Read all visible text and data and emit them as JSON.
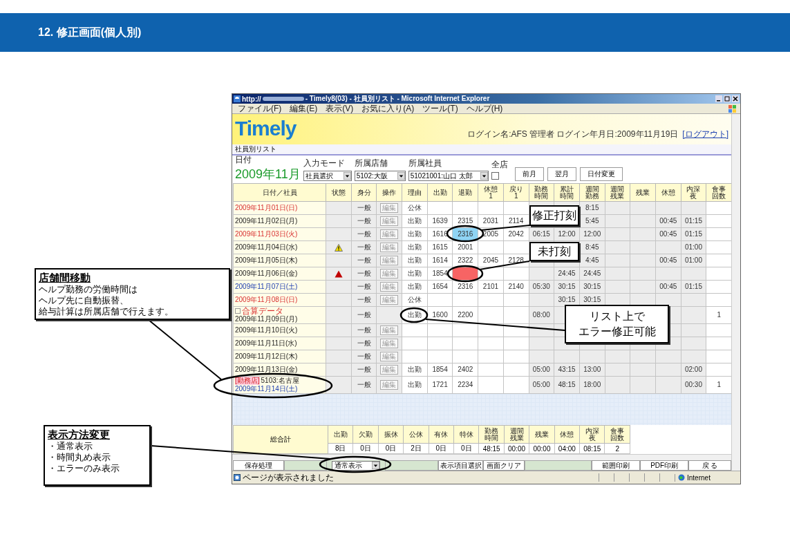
{
  "slide": {
    "title": "12. 修正画面(個人別)"
  },
  "browser": {
    "title_prefix": "http://",
    "title": " - Timely8(03) - 社員別リスト - Microsoft Internet Explorer",
    "menu": [
      "ファイル(F)",
      "編集(E)",
      "表示(V)",
      "お気に入り(A)",
      "ツール(T)",
      "ヘルプ(H)"
    ],
    "status_text": "ページが表示されました",
    "zone": "Internet"
  },
  "app": {
    "logo": "Timely",
    "login": "ログイン名:AFS 管理者 ログイン年月日:2009年11月19日",
    "logout": "[ログアウト]",
    "page_title": "社員別リスト"
  },
  "form": {
    "date_label": "日付",
    "month": "2009年11月",
    "fields": [
      {
        "label": "入力モード",
        "value": "社員選択"
      },
      {
        "label": "所属店舗",
        "value": "5102:大阪"
      },
      {
        "label": "所属社員",
        "value": "51021001:山口 太郎"
      }
    ],
    "all_stores": {
      "label": "全店",
      "checked": false
    },
    "buttons": [
      "前月",
      "翌月",
      "日付変更"
    ]
  },
  "table": {
    "columns": [
      "日付／社員",
      "状態",
      "身分",
      "操作",
      "理由",
      "出勤",
      "退勤",
      "休憩1",
      "戻り1",
      "勤務時間",
      "累計時間",
      "週間勤務",
      "週間残業",
      "残業",
      "休憩",
      "内深夜",
      "食事回数"
    ],
    "rows": [
      {
        "cells": [
          {
            "text": "2009年11月01日(日)",
            "kind": "holiday"
          },
          "",
          "一般",
          {
            "text": "編集",
            "kind": "button"
          },
          "公休",
          "",
          "",
          "",
          "",
          "",
          "",
          "8:15",
          "",
          "",
          "",
          "",
          ""
        ]
      },
      {
        "cells": [
          {
            "text": "2009年11月02日(月)",
            "kind": "weekday"
          },
          "",
          "一般",
          {
            "text": "編集",
            "kind": "button"
          },
          "出勤",
          "1639",
          "2315",
          "2031",
          "2114",
          "",
          "",
          "5:45",
          "",
          "",
          "00:45",
          "01:15",
          ""
        ]
      },
      {
        "cells": [
          {
            "text": "2009年11月03日(火)",
            "kind": "holiday"
          },
          "",
          "一般",
          {
            "text": "編集",
            "kind": "button"
          },
          "出勤",
          "1616",
          {
            "text": "2316",
            "kind": "corrected"
          },
          "2005",
          "2042",
          "06:15",
          "12:00",
          "12:00",
          "",
          "",
          "00:45",
          "01:15",
          ""
        ]
      },
      {
        "cells": [
          {
            "text": "2009年11月04日(水)",
            "kind": "weekday"
          },
          {
            "kind": "warning"
          },
          "一般",
          {
            "text": "編集",
            "kind": "button"
          },
          "出勤",
          "1615",
          "2001",
          "",
          "",
          "",
          "",
          "8:45",
          "",
          "",
          "",
          "01:00",
          ""
        ]
      },
      {
        "cells": [
          {
            "text": "2009年11月05日(木)",
            "kind": "weekday"
          },
          "",
          "一般",
          {
            "text": "編集",
            "kind": "button"
          },
          "出勤",
          "1614",
          "2322",
          "2045",
          "2128",
          "",
          "",
          "4:45",
          "",
          "",
          "00:45",
          "01:00",
          ""
        ]
      },
      {
        "cells": [
          {
            "text": "2009年11月06日(金)",
            "kind": "weekday"
          },
          {
            "kind": "error"
          },
          "一般",
          {
            "text": "編集",
            "kind": "button"
          },
          "出勤",
          "1854",
          {
            "kind": "missing"
          },
          "",
          "",
          "",
          "24:45",
          "24:45",
          "",
          "",
          "",
          "",
          ""
        ]
      },
      {
        "cells": [
          {
            "text": "2009年11月07日(土)",
            "kind": "saturday"
          },
          "",
          "一般",
          {
            "text": "編集",
            "kind": "button"
          },
          "出勤",
          "1654",
          "2316",
          "2101",
          "2140",
          "05:30",
          "30:15",
          "30:15",
          "",
          "",
          "00:45",
          "01:15",
          ""
        ]
      },
      {
        "cells": [
          {
            "text": "2009年11月08日(日)",
            "kind": "holiday"
          },
          "",
          "一般",
          {
            "text": "編集",
            "kind": "button"
          },
          "公休",
          "",
          "",
          "",
          "",
          "",
          "30:15",
          "30:15",
          "",
          "",
          "",
          "",
          ""
        ]
      },
      {
        "cells": [
          {
            "text": "2009年11月09日(月)",
            "kind": "weekday",
            "note": "合算データ",
            "note_checked": false
          },
          "",
          "一般",
          "",
          "出勤",
          "1600",
          "2200",
          "",
          "",
          "08:00",
          "",
          "",
          "",
          "",
          "",
          "",
          "1"
        ]
      },
      {
        "cells": [
          {
            "text": "2009年11月10日(火)",
            "kind": "weekday"
          },
          "",
          "一般",
          {
            "text": "編集",
            "kind": "button"
          },
          "",
          "",
          "",
          "",
          "",
          "",
          "",
          "",
          "",
          "",
          "",
          "",
          ""
        ]
      },
      {
        "cells": [
          {
            "text": "2009年11月11日(水)",
            "kind": "weekday"
          },
          "",
          "一般",
          {
            "text": "編集",
            "kind": "button"
          },
          "",
          "",
          "",
          "",
          "",
          "",
          "",
          "",
          "",
          "",
          "",
          "",
          ""
        ]
      },
      {
        "cells": [
          {
            "text": "2009年11月12日(木)",
            "kind": "weekday"
          },
          "",
          "一般",
          {
            "text": "編集",
            "kind": "button"
          },
          "",
          "",
          "",
          "",
          "",
          "",
          "",
          "",
          "",
          "",
          "",
          "",
          ""
        ]
      },
      {
        "cells": [
          {
            "text": "2009年11月13日(金)",
            "kind": "weekday"
          },
          "",
          "一般",
          {
            "text": "編集",
            "kind": "button"
          },
          "出勤",
          "1854",
          "2402",
          "",
          "",
          "05:00",
          "43:15",
          "13:00",
          "",
          "",
          "",
          "02:00",
          ""
        ]
      },
      {
        "cells": [
          {
            "text": "2009年11月14日(土)",
            "kind": "saturday",
            "store_tag": "[勤務店]",
            "store": "5103:名古屋"
          },
          "",
          "一般",
          {
            "text": "編集",
            "kind": "button"
          },
          "出勤",
          "1721",
          "2234",
          "",
          "",
          "05:00",
          "48:15",
          "18:00",
          "",
          "",
          "",
          "00:30",
          "1"
        ]
      }
    ]
  },
  "totals": {
    "label": "総合計",
    "columns": [
      {
        "label": "出勤",
        "value": "8日"
      },
      {
        "label": "欠勤",
        "value": "0日"
      },
      {
        "label": "振休",
        "value": "0日"
      },
      {
        "label": "公休",
        "value": "2日"
      },
      {
        "label": "有休",
        "value": "0日"
      },
      {
        "label": "特休",
        "value": "0日"
      },
      {
        "label": "勤務時間",
        "value": "48:15"
      },
      {
        "label": "週間残業",
        "value": "00:00"
      },
      {
        "label": "残業",
        "value": "00:00"
      },
      {
        "label": "休憩",
        "value": "04:00"
      },
      {
        "label": "内深夜",
        "value": "08:15"
      },
      {
        "label": "食事回数",
        "value": "2"
      }
    ]
  },
  "actions": [
    {
      "kind": "button",
      "label": "保存処理"
    },
    {
      "kind": "gap"
    },
    {
      "kind": "select",
      "label": "通常表示"
    },
    {
      "kind": "gap"
    },
    {
      "kind": "button",
      "label": "表示項目選択"
    },
    {
      "kind": "button",
      "label": "画面クリア"
    },
    {
      "kind": "gap"
    },
    {
      "kind": "button",
      "label": "範囲印刷"
    },
    {
      "kind": "button",
      "label": "PDF印刷"
    },
    {
      "kind": "button",
      "label": "戻 る"
    }
  ],
  "callouts": [
    {
      "kind": "note",
      "title": "店舗間移動",
      "lines": [
        "ヘルプ勤務の労働時間は",
        "ヘルプ先に自動振替、",
        "給与計算は所属店舗で行えます。"
      ]
    },
    {
      "kind": "note",
      "title": "表示方法変更",
      "lines": [
        "・通常表示",
        "・時間丸め表示",
        "・エラーのみ表示"
      ]
    },
    {
      "kind": "label",
      "lines": [
        "修正打刻"
      ]
    },
    {
      "kind": "label",
      "lines": [
        "未打刻"
      ]
    },
    {
      "kind": "label",
      "lines": [
        "リスト上で",
        "エラー修正可能"
      ]
    }
  ]
}
